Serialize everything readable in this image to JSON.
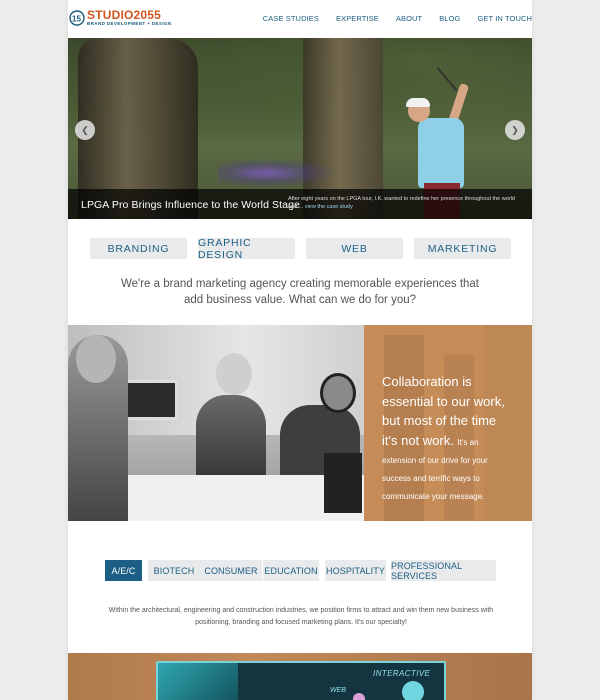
{
  "brand": {
    "name_prefix": "STUDIO",
    "name_suffix": "2055",
    "tagline": "BRAND DEVELOPMENT + DESIGN",
    "colors": {
      "accent": "#d2541f",
      "primary": "#1d5f84",
      "panel": "#c58c58"
    }
  },
  "nav": {
    "items": [
      {
        "label": "CASE STUDIES"
      },
      {
        "label": "EXPERTISE"
      },
      {
        "label": "ABOUT"
      },
      {
        "label": "BLOG"
      },
      {
        "label": "GET IN TOUCH"
      }
    ]
  },
  "hero": {
    "title": "LPGA Pro Brings Influence to the World Stage",
    "text": "After eight years on the LPGA tour, I.K. wanted to redefine her presence throughout the world and ...",
    "link_text": "view the case study",
    "prev_icon": "chevron-left-icon",
    "next_icon": "chevron-right-icon"
  },
  "services": [
    {
      "label": "BRANDING"
    },
    {
      "label": "GRAPHIC DESIGN"
    },
    {
      "label": "WEB"
    },
    {
      "label": "MARKETING"
    }
  ],
  "intro": {
    "line1": "We're a brand marketing agency creating memorable experiences that",
    "line2": "add business value. What can we do for you?"
  },
  "collab": {
    "big_text": "Collaboration is essential to our work, but most of the time it's not work.",
    "small_text": "It's an extension of our drive for your success and terrific ways to communicate your message."
  },
  "industries": {
    "tabs": [
      {
        "label": "A/E/C",
        "active": true
      },
      {
        "label": "BIOTECH",
        "active": false
      },
      {
        "label": "CONSUMER",
        "active": false
      },
      {
        "label": "EDUCATION",
        "active": false
      },
      {
        "label": "HOSPITALITY",
        "active": false
      },
      {
        "label": "PROFESSIONAL SERVICES",
        "active": false
      }
    ],
    "description": "Within the architectural, engineering and construction industries, we position firms to attract and win them new business with positioning, branding and focused marketing plans. It's our specialty!"
  },
  "bottom_banner": {
    "label_interactive": "INTERACTIVE",
    "label_web": "WEB"
  }
}
